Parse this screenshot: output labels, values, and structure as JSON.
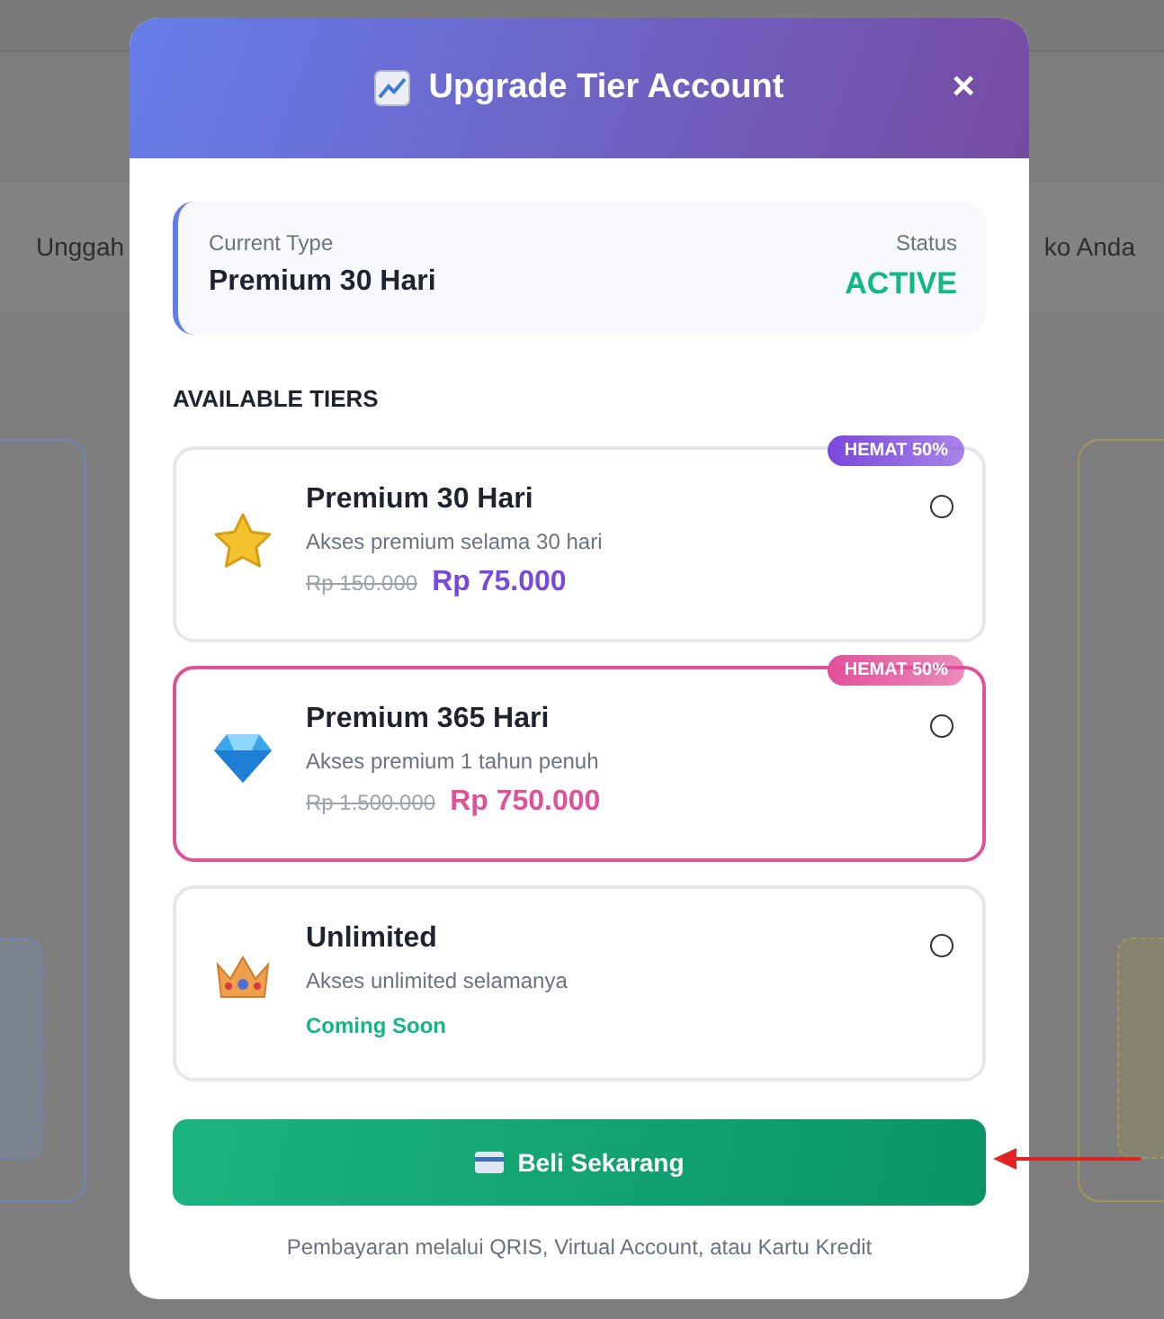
{
  "background": {
    "texts": [
      "Unggah",
      "ko Anda"
    ]
  },
  "modal": {
    "title": "Upgrade Tier Account",
    "close": "×"
  },
  "current": {
    "type_label": "Current Type",
    "type_value": "Premium 30 Hari",
    "status_label": "Status",
    "status_value": "ACTIVE"
  },
  "section_title": "AVAILABLE TIERS",
  "tiers": [
    {
      "kind": "price",
      "name": "Premium 30 Hari",
      "description": "Akses premium selama 30 hari",
      "old_price": "Rp 150.000",
      "price": "Rp 75.000",
      "badge": "HEMAT 50%",
      "color": "#7b48dc",
      "highlighted": false,
      "selected": false
    },
    {
      "kind": "price",
      "name": "Premium 365 Hari",
      "description": "Akses premium 1 tahun penuh",
      "old_price": "Rp 1.500.000",
      "price": "Rp 750.000",
      "badge": "HEMAT 50%",
      "color": "#e2509a",
      "highlighted": true,
      "selected": false
    },
    {
      "kind": "coming_soon",
      "name": "Unlimited",
      "description": "Akses unlimited selamanya",
      "status": "Coming Soon",
      "highlighted": false,
      "selected": false
    }
  ],
  "buy_button": "Beli Sekarang",
  "payment_note": "Pembayaran melalui QRIS, Virtual Account, atau Kartu Kredit"
}
